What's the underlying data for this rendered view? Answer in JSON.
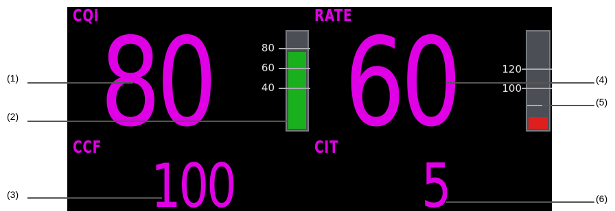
{
  "colors": {
    "value": "#e000e6",
    "cqi_bar": "#19b01e",
    "rate_bar": "#e01e1e",
    "frame": "#4b4f55",
    "background": "#000000"
  },
  "cqi": {
    "label": "CQI",
    "value": "80",
    "scale": {
      "ticks": [
        "80",
        "60",
        "40"
      ],
      "level": 80,
      "max": 100
    }
  },
  "rate": {
    "label": "RATE",
    "value": "60",
    "scale": {
      "ticks": [
        "120",
        "100"
      ],
      "level": 60,
      "max": 240
    }
  },
  "ccf": {
    "label": "CCF",
    "value": "100"
  },
  "cit": {
    "label": "CIT",
    "value": "5"
  },
  "callouts": [
    "(1)",
    "(2)",
    "(3)",
    "(4)",
    "(5)",
    "(6)"
  ]
}
